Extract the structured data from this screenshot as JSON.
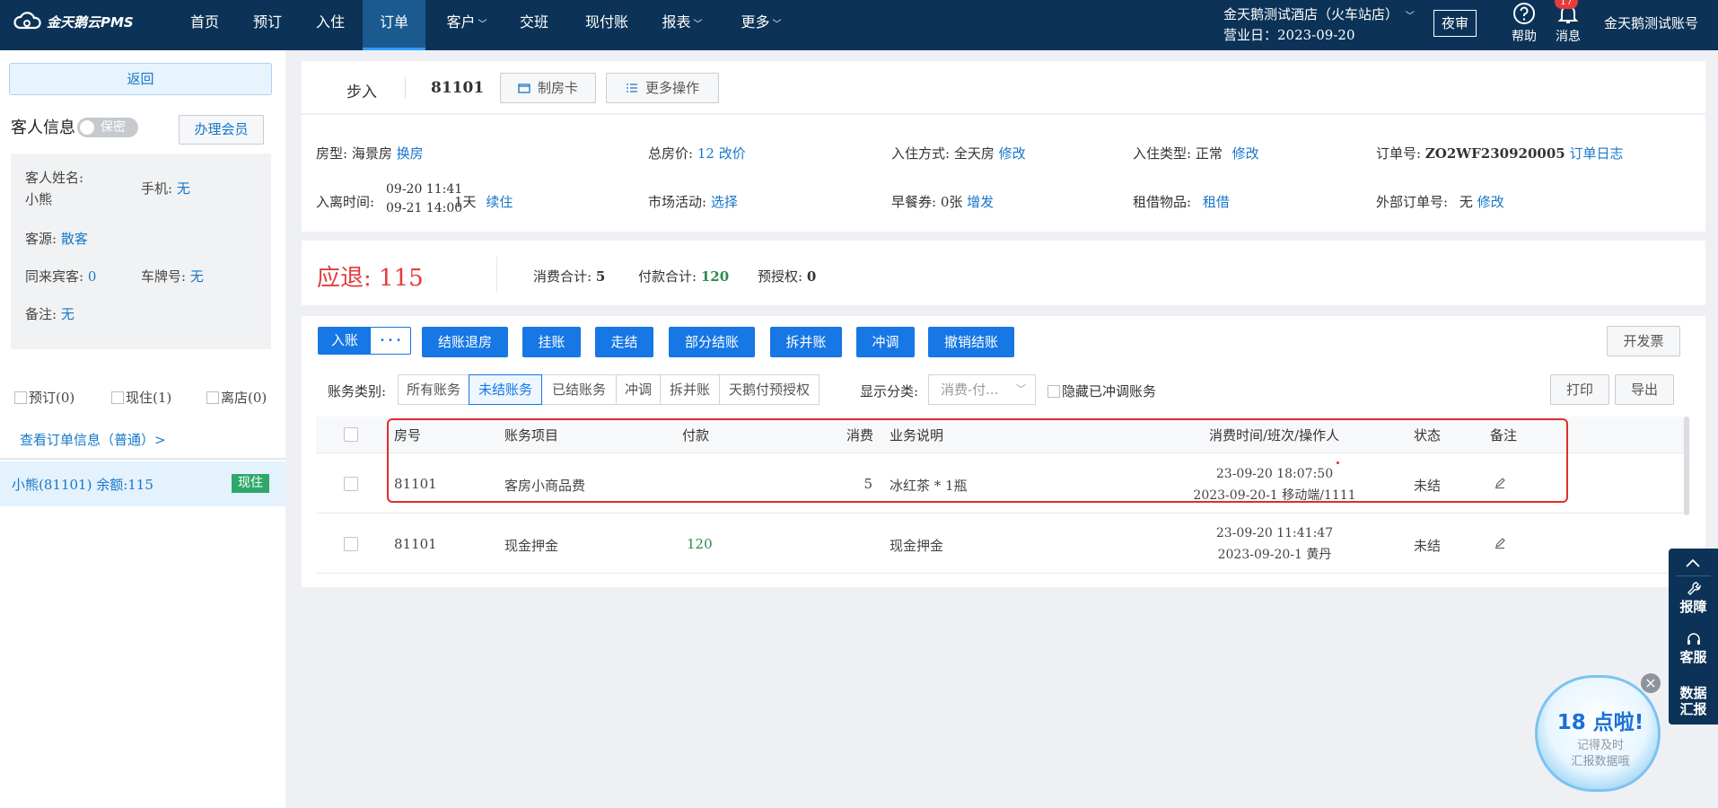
{
  "app": {
    "logo": "金天鹅云PMS"
  },
  "nav": {
    "items": [
      "首页",
      "预订",
      "入住",
      "订单",
      "客户",
      "交班",
      "现付账",
      "报表",
      "更多"
    ],
    "hotel_name": "金天鹅测试酒店（火车站店）",
    "business_date": "营业日：2023-09-20",
    "night_audit": "夜审",
    "help": "帮助",
    "messages": "消息",
    "message_count": "17",
    "account": "金天鹅测试账号"
  },
  "sidebar": {
    "back": "返回",
    "guest_title": "客人信息",
    "privacy": "保密",
    "member_btn": "办理会员",
    "name_label": "客人姓名:",
    "name_value": "小熊",
    "phone_label": "手机:",
    "phone_value": "无",
    "source_label": "客源:",
    "source_value": "散客",
    "companions_label": "同来宾客:",
    "companions_value": "0",
    "plate_label": "车牌号:",
    "plate_value": "无",
    "remark_label": "备注:",
    "remark_value": "无",
    "check_reserved": "预订(0)",
    "check_inhouse": "现住(1)",
    "check_departed": "离店(0)",
    "view_order": "查看订单信息（普通）>",
    "room_entry": "小熊(81101)  余额:115",
    "room_status": "现住"
  },
  "order": {
    "mode": "步入",
    "room_no": "81101",
    "make_card": "制房卡",
    "more_ops": "更多操作"
  },
  "details": {
    "room_type_label": "房型:",
    "room_type": "海景房",
    "change_room": "换房",
    "total_price_label": "总房价:",
    "total_price": "12",
    "change_price": "改价",
    "checkin_mode_label": "入住方式:",
    "checkin_mode": "全天房",
    "modify": "修改",
    "checkin_type_label": "入住类型:",
    "checkin_type": "正常",
    "order_no_label": "订单号:",
    "order_no": "ZO2WF230920005",
    "order_log": "订单日志",
    "stay_label": "入离时间:",
    "arrive": "09-20 11:41",
    "depart": "09-21 14:00",
    "nights": "1天",
    "extend": "续住",
    "market_label": "市场活动:",
    "market_choose": "选择",
    "breakfast_label": "早餐券:",
    "breakfast": "0张",
    "breakfast_add": "增发",
    "rental_label": "租借物品:",
    "rental_link": "租借",
    "external_label": "外部订单号:",
    "external": "无"
  },
  "summary": {
    "refund_label": "应退:",
    "refund_value": "115",
    "consume_label": "消费合计:",
    "consume_value": "5",
    "payment_label": "付款合计:",
    "payment_value": "120",
    "preauth_label": "预授权:",
    "preauth_value": "0"
  },
  "actions": {
    "post": "入账",
    "more": "• • •",
    "checkout": "结账退房",
    "hang": "挂账",
    "walk": "走结",
    "partial": "部分结账",
    "split": "拆并账",
    "offset": "冲调",
    "cancel_checkout": "撤销结账",
    "invoice": "开发票"
  },
  "filters": {
    "category_label": "账务类别:",
    "segments": [
      "所有账务",
      "未结账务",
      "已结账务",
      "冲调",
      "拆并账",
      "天鹅付预授权"
    ],
    "display_label": "显示分类:",
    "display_value": "消费-付...",
    "hide_offset": "隐藏已冲调账务",
    "print": "打印",
    "export": "导出"
  },
  "table": {
    "columns": [
      "房号",
      "账务项目",
      "付款",
      "消费",
      "业务说明",
      "消费时间/班次/操作人",
      "状态",
      "备注"
    ],
    "rows": [
      {
        "room": "81101",
        "item": "客房小商品费",
        "pay": "",
        "consume": "5",
        "desc": "冰红茶 * 1瓶",
        "time": "23-09-20 18:07:50",
        "shift": "2023-09-20-1 移动端/1111",
        "status": "未结"
      },
      {
        "room": "81101",
        "item": "现金押金",
        "pay": "120",
        "consume": "",
        "desc": "现金押金",
        "time": "23-09-20 11:41:47",
        "shift": "2023-09-20-1 黄丹",
        "status": "未结"
      }
    ]
  },
  "float": {
    "fault": "报障",
    "service": "客服",
    "data1": "数据",
    "data2": "汇报"
  },
  "bubble": {
    "big": "18 点啦!",
    "line1": "记得及时",
    "line2": "汇报数据哦"
  },
  "colors": {
    "nav_bg": "#0c3357",
    "accent": "#1677e5",
    "refund": "#e43b3b",
    "payment": "#2f8a4f",
    "highlight_box": "#e02d2d"
  }
}
